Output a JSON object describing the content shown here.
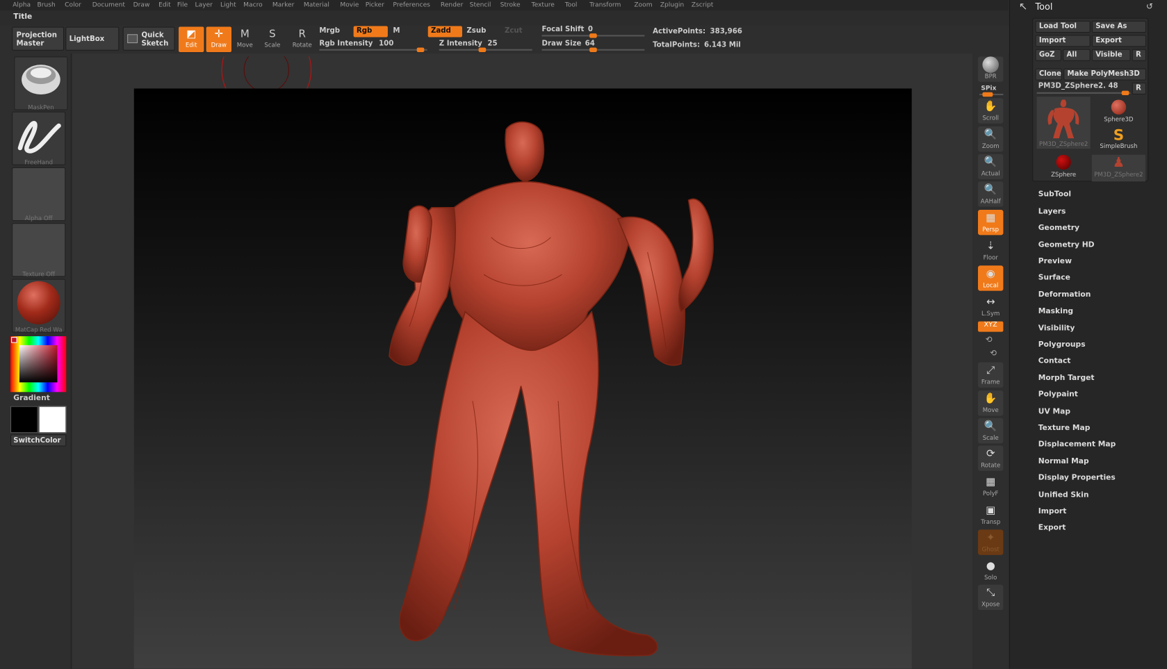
{
  "menu": [
    "Alpha",
    "Brush",
    "Color",
    "Document",
    "Draw",
    "Edit",
    "File",
    "Layer",
    "Light",
    "Macro",
    "Marker",
    "Material",
    "Movie",
    "Picker",
    "Preferences",
    "Render",
    "Stencil",
    "Stroke",
    "Texture",
    "Tool",
    "Transform",
    "Zoom",
    "Zplugin",
    "Zscript"
  ],
  "title": "Title",
  "topshelf": {
    "projection_master": "Projection Master",
    "lightbox": "LightBox",
    "quick_sketch": "Quick Sketch",
    "edit": "Edit",
    "draw": "Draw",
    "move": "Move",
    "scale": "Scale",
    "rotate": "Rotate",
    "mrgb": "Mrgb",
    "rgb": "Rgb",
    "m": "M",
    "zadd": "Zadd",
    "zsub": "Zsub",
    "zcut": "Zcut",
    "rgb_intensity_label": "Rgb Intensity",
    "rgb_intensity": "100",
    "z_intensity_label": "Z Intensity",
    "z_intensity": "25",
    "focal_shift_label": "Focal Shift",
    "focal_shift": "0",
    "draw_size_label": "Draw Size",
    "draw_size": "64",
    "active_points_label": "ActivePoints:",
    "active_points": "383,966",
    "total_points_label": "TotalPoints:",
    "total_points": "6.143 Mil"
  },
  "leftshelf": {
    "brush": "MaskPen",
    "stroke": "FreeHand",
    "alpha": "Alpha Off",
    "texture": "Texture Off",
    "material": "MatCap Red Wa",
    "gradient": "Gradient",
    "switch_color": "SwitchColor"
  },
  "rightshelf": [
    "BPR",
    "SPix",
    "Scroll",
    "Zoom",
    "Actual",
    "AAHalf",
    "Persp",
    "Floor",
    "Local",
    "L.Sym",
    "XYZ",
    "Frame",
    "Move",
    "Scale",
    "Rotate",
    "PolyF",
    "Transp",
    "Ghost",
    "Solo",
    "Xpose"
  ],
  "toolpanel": {
    "title": "Tool",
    "load_tool": "Load Tool",
    "save_as": "Save As",
    "import": "Import",
    "export": "Export",
    "goz": "GoZ",
    "all": "All",
    "visible": "Visible",
    "r": "R",
    "clone": "Clone",
    "make_polymesh": "Make PolyMesh3D",
    "current_tool": "PM3D_ZSphere2. 48",
    "thumbs": [
      "PM3D_ZSphere2",
      "Sphere3D",
      "SimpleBrush",
      "ZSphere",
      "PM3D_ZSphere2"
    ],
    "items": [
      "SubTool",
      "Layers",
      "Geometry",
      "Geometry HD",
      "Preview",
      "Surface",
      "Deformation",
      "Masking",
      "Visibility",
      "Polygroups",
      "Contact",
      "Morph Target",
      "Polypaint",
      "UV Map",
      "Texture Map",
      "Displacement Map",
      "Normal Map",
      "Display Properties",
      "Unified Skin",
      "Import",
      "Export"
    ]
  },
  "colors": {
    "accent": "#f07a1a",
    "model": "#b5422f",
    "background": "#2c2c2c"
  }
}
